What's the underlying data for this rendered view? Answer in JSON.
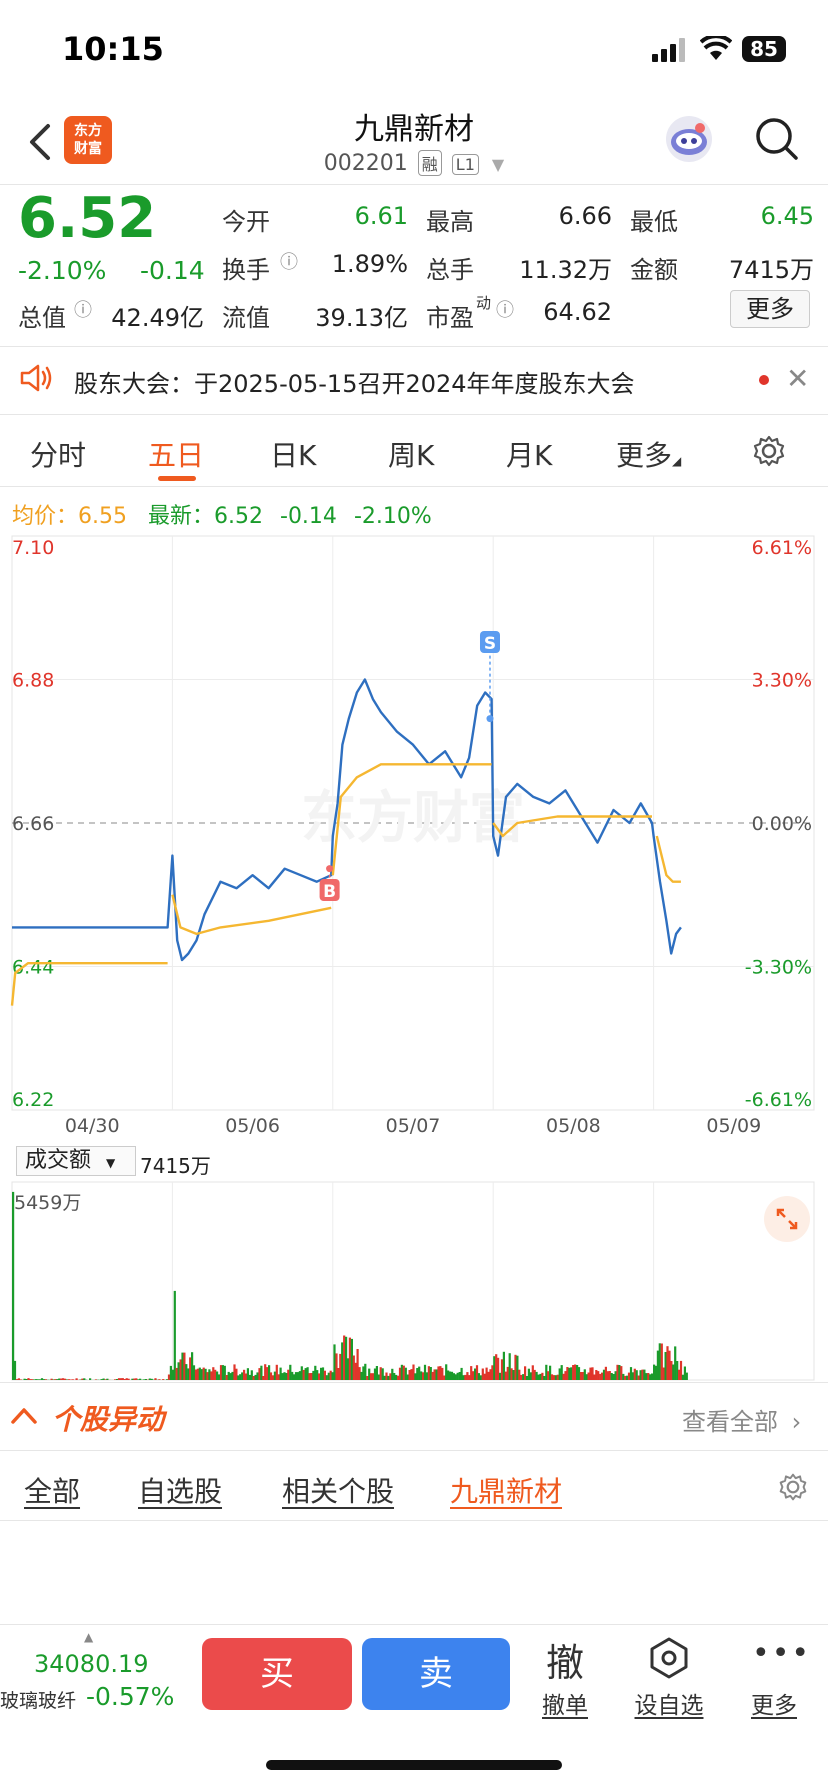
{
  "status_bar": {
    "time": "10:15",
    "battery": "85"
  },
  "header": {
    "logo_line1": "东方",
    "logo_line2": "财富",
    "stock_name": "九鼎新材",
    "stock_code": "002201",
    "tags": [
      "融",
      "L1"
    ]
  },
  "quote": {
    "price": "6.52",
    "change_pct": "-2.10%",
    "change": "-0.14",
    "fields": [
      {
        "label": "今开",
        "value": "6.61",
        "color": "green"
      },
      {
        "label": "最高",
        "value": "6.66",
        "color": "black"
      },
      {
        "label": "最低",
        "value": "6.45",
        "color": "green"
      },
      {
        "label": "换手",
        "value": "1.89%",
        "color": "black"
      },
      {
        "label": "总手",
        "value": "11.32万",
        "color": "black"
      },
      {
        "label": "金额",
        "value": "7415万",
        "color": "black"
      },
      {
        "label": "总值",
        "value": "42.49亿",
        "color": "black"
      },
      {
        "label": "流值",
        "value": "39.13亿",
        "color": "black"
      },
      {
        "label": "市盈",
        "value": "64.62",
        "color": "black"
      }
    ],
    "pe_superscript": "动",
    "more_label": "更多"
  },
  "notice": {
    "text": "股东大会：于2025-05-15召开2024年年度股东大会"
  },
  "tabs": [
    "分时",
    "五日",
    "日K",
    "周K",
    "月K",
    "更多"
  ],
  "active_tab": "五日",
  "chart_info": {
    "avg_label": "均价：",
    "avg_value": "6.55",
    "latest_label": "最新：",
    "latest_value": "6.52",
    "latest_change": "-0.14",
    "latest_pct": "-2.10%"
  },
  "chart_data": {
    "type": "line",
    "x_labels": [
      "04/30",
      "05/06",
      "05/07",
      "05/08",
      "05/09"
    ],
    "y_left_ticks": [
      "7.10",
      "6.88",
      "6.66",
      "6.44",
      "6.22"
    ],
    "y_right_ticks": [
      "6.61%",
      "3.30%",
      "0.00%",
      "-3.30%",
      "-6.61%"
    ],
    "ylim": [
      6.22,
      7.1
    ],
    "prev_close": 6.66,
    "watermark": "东方财富",
    "series": [
      {
        "points": [
          [
            0.0,
            6.5
          ],
          [
            0.97,
            6.5
          ],
          [
            1.0,
            6.61
          ],
          [
            1.03,
            6.48
          ],
          [
            1.06,
            6.45
          ],
          [
            1.1,
            6.46
          ],
          [
            1.15,
            6.48
          ],
          [
            1.2,
            6.52
          ],
          [
            1.3,
            6.57
          ],
          [
            1.4,
            6.56
          ],
          [
            1.5,
            6.58
          ],
          [
            1.6,
            6.56
          ],
          [
            1.7,
            6.59
          ],
          [
            1.8,
            6.58
          ],
          [
            1.9,
            6.57
          ],
          [
            1.99,
            6.58
          ],
          [
            2.0,
            6.64
          ],
          [
            2.03,
            6.69
          ],
          [
            2.06,
            6.78
          ],
          [
            2.1,
            6.82
          ],
          [
            2.15,
            6.86
          ],
          [
            2.2,
            6.88
          ],
          [
            2.25,
            6.85
          ],
          [
            2.3,
            6.83
          ],
          [
            2.4,
            6.8
          ],
          [
            2.5,
            6.78
          ],
          [
            2.6,
            6.75
          ],
          [
            2.7,
            6.77
          ],
          [
            2.8,
            6.73
          ],
          [
            2.85,
            6.76
          ],
          [
            2.9,
            6.84
          ],
          [
            2.95,
            6.86
          ],
          [
            2.99,
            6.85
          ],
          [
            3.0,
            6.64
          ],
          [
            3.03,
            6.61
          ],
          [
            3.08,
            6.7
          ],
          [
            3.15,
            6.72
          ],
          [
            3.25,
            6.7
          ],
          [
            3.35,
            6.69
          ],
          [
            3.45,
            6.71
          ],
          [
            3.55,
            6.67
          ],
          [
            3.65,
            6.63
          ],
          [
            3.75,
            6.68
          ],
          [
            3.85,
            6.66
          ],
          [
            3.92,
            6.69
          ],
          [
            3.99,
            6.66
          ],
          [
            4.0,
            6.64
          ],
          [
            4.04,
            6.57
          ],
          [
            4.08,
            6.51
          ],
          [
            4.11,
            6.46
          ],
          [
            4.14,
            6.49
          ],
          [
            4.17,
            6.5
          ]
        ]
      },
      {
        "points": [
          [
            0.0,
            6.38
          ],
          [
            0.02,
            6.43
          ],
          [
            0.1,
            6.445
          ],
          [
            0.97,
            6.445
          ],
          [
            1.0,
            6.55
          ],
          [
            1.05,
            6.5
          ],
          [
            1.15,
            6.49
          ],
          [
            1.3,
            6.5
          ],
          [
            1.6,
            6.51
          ],
          [
            1.99,
            6.53
          ],
          [
            2.0,
            6.58
          ],
          [
            2.05,
            6.7
          ],
          [
            2.15,
            6.73
          ],
          [
            2.3,
            6.75
          ],
          [
            2.6,
            6.75
          ],
          [
            2.99,
            6.75
          ],
          [
            3.0,
            6.66
          ],
          [
            3.06,
            6.64
          ],
          [
            3.15,
            6.66
          ],
          [
            3.4,
            6.67
          ],
          [
            3.8,
            6.67
          ],
          [
            3.99,
            6.67
          ],
          [
            4.02,
            6.64
          ],
          [
            4.08,
            6.58
          ],
          [
            4.12,
            6.57
          ],
          [
            4.17,
            6.57
          ]
        ]
      }
    ],
    "markers": [
      {
        "label": "B",
        "day_pos": 1.98,
        "price": 6.59,
        "color": "#f06a6a"
      },
      {
        "label": "S",
        "day_pos": 2.98,
        "price": 6.82,
        "color": "#5b9cf0"
      }
    ]
  },
  "volume": {
    "select_label": "成交额",
    "total": "7415万",
    "max_label": "5459万"
  },
  "anomaly": {
    "title": "个股异动",
    "view_all": "查看全部",
    "filters": [
      "全部",
      "自选股",
      "相关个股",
      "九鼎新材"
    ],
    "active_filter": "九鼎新材"
  },
  "bottom_bar": {
    "index_value": "34080.19",
    "index_name": "玻璃玻纤",
    "index_pct": "-0.57%",
    "buy_label": "买",
    "sell_label": "卖",
    "cancel_glyph": "撤",
    "cancel_label": "撤单",
    "watch_label": "设自选",
    "more_label": "更多"
  }
}
